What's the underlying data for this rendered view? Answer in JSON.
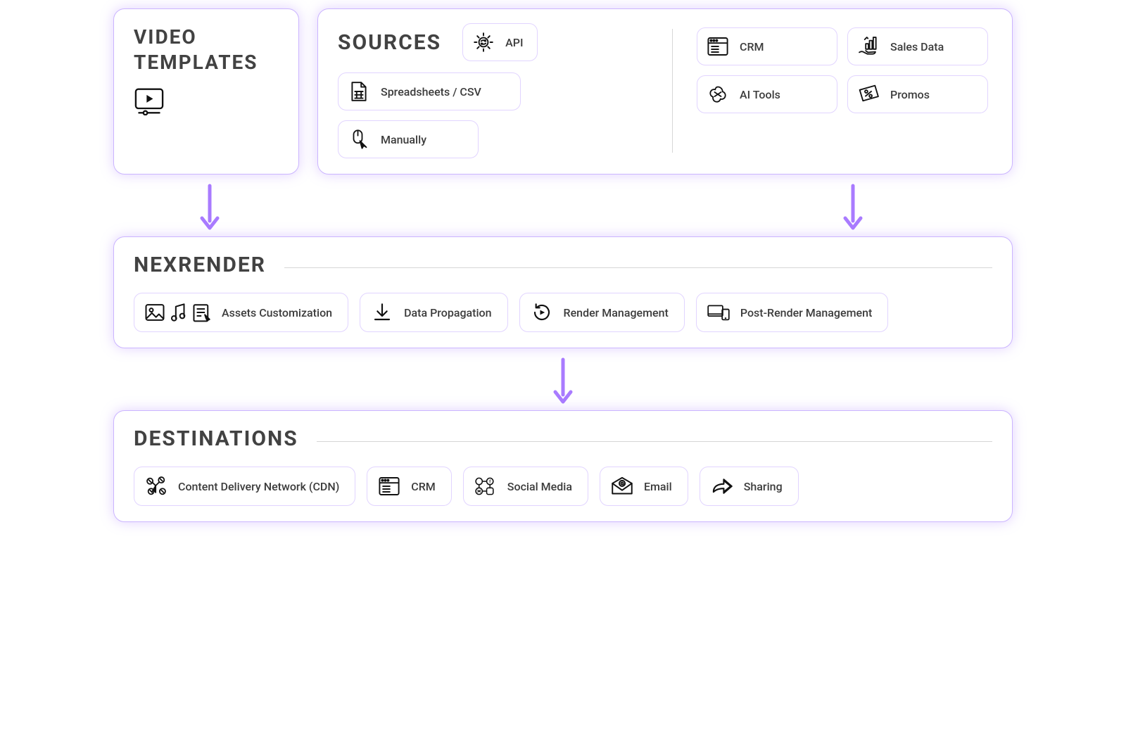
{
  "video_templates": {
    "title": "VIDEO TEMPLATES"
  },
  "sources": {
    "title": "SOURCES",
    "api": "API",
    "spreadsheets": "Spreadsheets / CSV",
    "manually": "Manually",
    "crm": "CRM",
    "sales": "Sales Data",
    "ai": "AI Tools",
    "promos": "Promos"
  },
  "nexrender": {
    "title": "NEXRENDER",
    "assets": "Assets Customization",
    "data": "Data Propagation",
    "render": "Render Management",
    "post": "Post-Render Management"
  },
  "destinations": {
    "title": "DESTINATIONS",
    "cdn": "Content Delivery Network (CDN)",
    "crm": "CRM",
    "social": "Social Media",
    "email": "Email",
    "sharing": "Sharing"
  }
}
